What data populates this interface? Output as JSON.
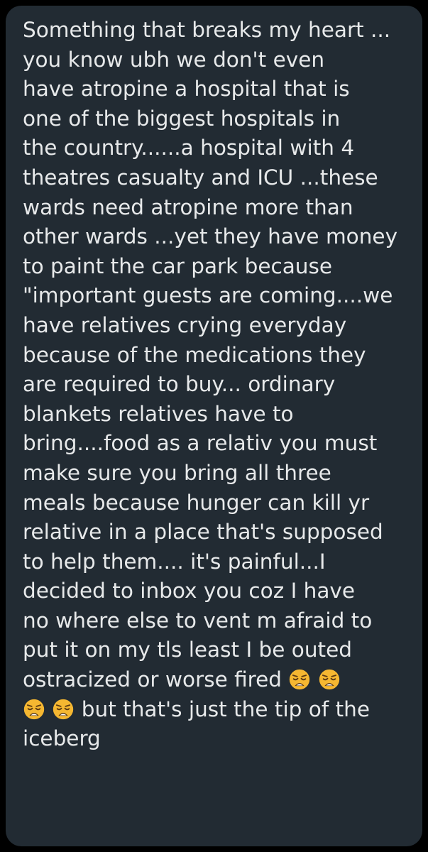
{
  "message": {
    "lines_before_emoji": [
      "Something that breaks my heart ...",
      "you know ubh we don't even",
      "have atropine a hospital that is",
      "one of the biggest hospitals in",
      "the country......a hospital with 4",
      "theatres casualty and ICU ...these",
      "wards need atropine more than",
      "other wards ...yet they have money",
      "to paint the car park because",
      "\"important guests are coming....we",
      "have relatives crying everyday",
      "because of the medications they",
      "are required to buy... ordinary",
      "blankets relatives have to",
      "bring....food as a relativ you must",
      "make sure you bring all three",
      "meals because hunger can kill yr",
      "relative in a place that's supposed",
      "to help them.... it's painful...I",
      "decided to inbox you coz I have",
      "no where else to vent m afraid to",
      "put it on my tls least I be outed"
    ],
    "line_23_text": "ostracized or worse fired ",
    "line_24_text": " but that's just the tip of the",
    "line_25_text": "iceberg",
    "emoji_name": "weary-face",
    "emoji_color": "#f5b731"
  }
}
